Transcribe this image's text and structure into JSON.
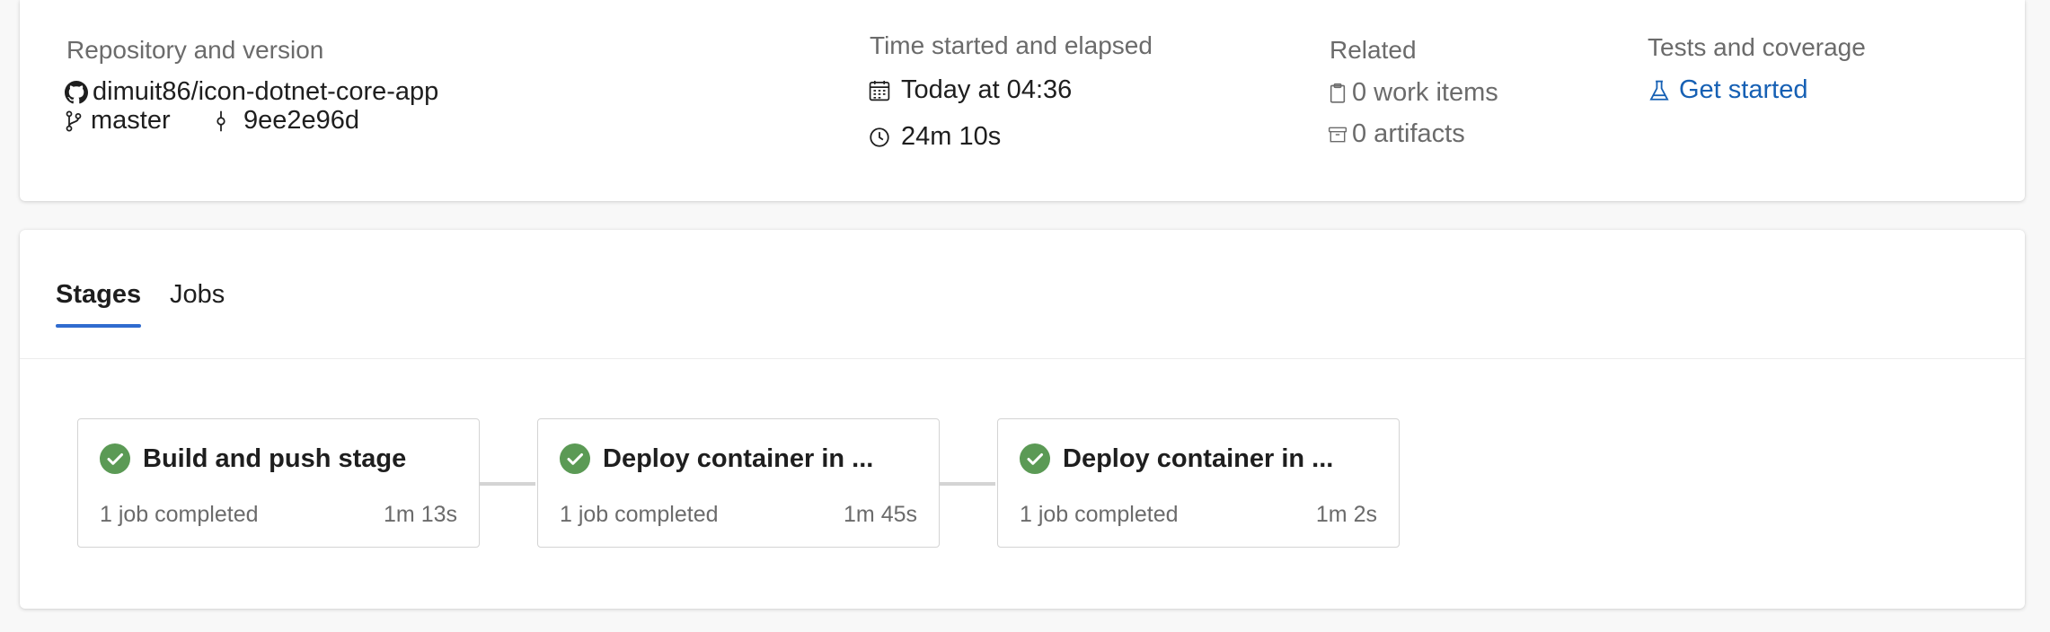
{
  "summary": {
    "repo": {
      "title": "Repository and version",
      "repo_name": "dimuit86/icon-dotnet-core-app",
      "branch": "master",
      "commit": "9ee2e96d"
    },
    "time": {
      "title": "Time started and elapsed",
      "started": "Today at 04:36",
      "elapsed": "24m 10s"
    },
    "related": {
      "title": "Related",
      "work_items": "0 work items",
      "artifacts": "0 artifacts"
    },
    "tests": {
      "title": "Tests and coverage",
      "link": "Get started"
    }
  },
  "tabs": [
    {
      "label": "Stages",
      "active": true
    },
    {
      "label": "Jobs",
      "active": false
    }
  ],
  "stages": [
    {
      "name": "Build and push stage",
      "status": "1 job completed",
      "duration": "1m 13s"
    },
    {
      "name": "Deploy container in ...",
      "status": "1 job completed",
      "duration": "1m 45s"
    },
    {
      "name": "Deploy container in ...",
      "status": "1 job completed",
      "duration": "1m 2s"
    }
  ],
  "colors": {
    "success": "#5b9a55",
    "link": "#1660b4",
    "tab_accent": "#2f6bcf"
  },
  "icons": {
    "repo": "github-icon",
    "branch": "branch-icon",
    "commit": "commit-icon",
    "started": "calendar-icon",
    "elapsed": "clock-icon",
    "work_items": "clipboard-icon",
    "artifacts": "artifact-box-icon",
    "tests": "flask-icon",
    "stage_status": "check-circle-icon"
  }
}
